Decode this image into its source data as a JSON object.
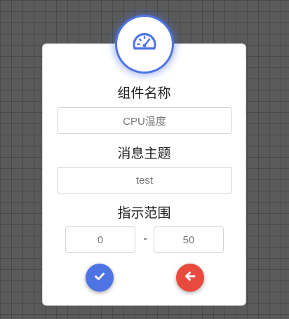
{
  "dialog": {
    "component_name": {
      "label": "组件名称",
      "value": "CPU温度"
    },
    "topic": {
      "label": "消息主题",
      "value": "test"
    },
    "range": {
      "label": "指示范围",
      "min": "0",
      "separator": "-",
      "max": "50"
    },
    "icons": {
      "badge": "speedometer-icon",
      "confirm": "check-icon",
      "back": "arrow-left-icon"
    },
    "colors": {
      "accent": "#4e74e3",
      "danger": "#e84a3d"
    }
  }
}
